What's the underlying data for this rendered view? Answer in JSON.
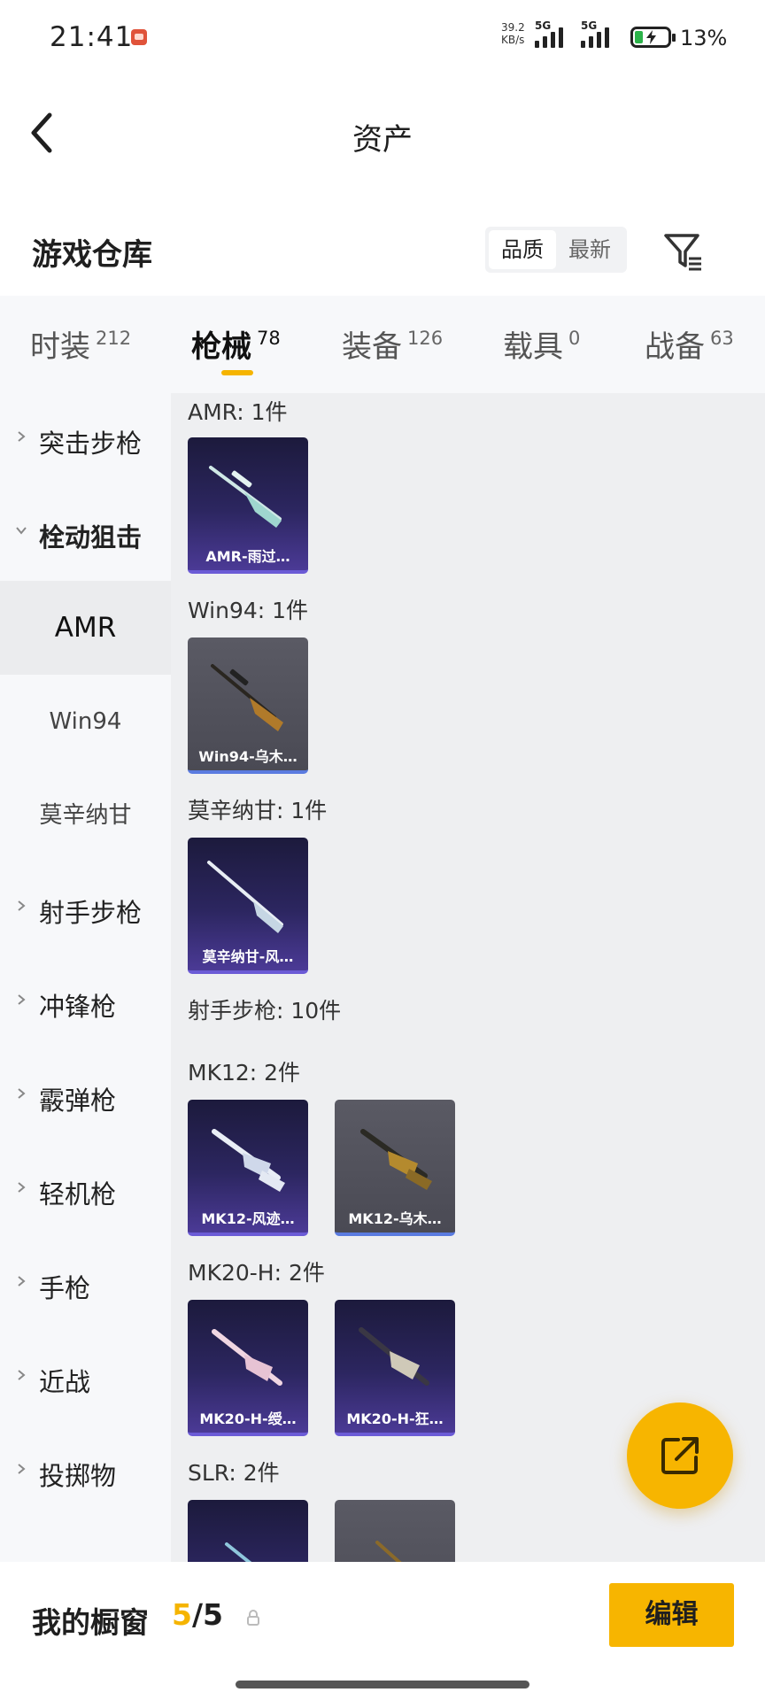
{
  "status_bar": {
    "time": "21:41",
    "net_speed_value": "39.2",
    "net_speed_unit": "KB/s",
    "signal_1": "5G",
    "signal_2": "5G",
    "battery_percent": "13%",
    "battery_level": 0.13,
    "colors": {
      "battery_fill": "#2cb34a"
    }
  },
  "header": {
    "title": "资产"
  },
  "toolbar": {
    "section_title": "游戏仓库",
    "sort_options": [
      "品质",
      "最新"
    ],
    "sort_selected": "品质"
  },
  "tabs": [
    {
      "label": "时装",
      "count": "212",
      "active": false
    },
    {
      "label": "枪械",
      "count": "78",
      "active": true
    },
    {
      "label": "装备",
      "count": "126",
      "active": false
    },
    {
      "label": "载具",
      "count": "0",
      "active": false
    },
    {
      "label": "战备",
      "count": "63",
      "active": false
    }
  ],
  "sidebar": {
    "categories": [
      {
        "label": "突击步枪",
        "expanded": false
      },
      {
        "label": "栓动狙击",
        "expanded": true
      },
      {
        "label": "射手步枪",
        "expanded": false
      },
      {
        "label": "冲锋枪",
        "expanded": false
      },
      {
        "label": "霰弹枪",
        "expanded": false
      },
      {
        "label": "轻机枪",
        "expanded": false
      },
      {
        "label": "手枪",
        "expanded": false
      },
      {
        "label": "近战",
        "expanded": false
      },
      {
        "label": "投掷物",
        "expanded": false
      }
    ],
    "subitems": [
      {
        "label": "AMR",
        "active": true
      },
      {
        "label": "Win94",
        "active": false
      },
      {
        "label": "莫辛纳甘",
        "active": false
      }
    ]
  },
  "content": {
    "groups": [
      {
        "label": "AMR: 1件",
        "items": [
          {
            "caption": "AMR-雨过…",
            "rarity": "purple"
          }
        ]
      },
      {
        "label": "Win94: 1件",
        "items": [
          {
            "caption": "Win94-乌木…",
            "rarity": "gray"
          }
        ]
      },
      {
        "label": "莫辛纳甘: 1件",
        "items": [
          {
            "caption": "莫辛纳甘-风…",
            "rarity": "purple"
          }
        ]
      },
      {
        "label": "射手步枪: 10件",
        "items": []
      },
      {
        "label": "MK12: 2件",
        "items": [
          {
            "caption": "MK12-风迹…",
            "rarity": "purple"
          },
          {
            "caption": "MK12-乌木…",
            "rarity": "gray"
          }
        ]
      },
      {
        "label": "MK20-H: 2件",
        "items": [
          {
            "caption": "MK20-H-绶…",
            "rarity": "purple"
          },
          {
            "caption": "MK20-H-狂…",
            "rarity": "purple"
          }
        ]
      },
      {
        "label": "SLR: 2件",
        "items": [
          {
            "caption": "",
            "rarity": "purple"
          },
          {
            "caption": "",
            "rarity": "gray"
          }
        ]
      }
    ]
  },
  "bottom_bar": {
    "title": "我的橱窗",
    "current": "5",
    "separator": "/",
    "total": "5",
    "edit_label": "编辑"
  },
  "colors": {
    "accent": "#f7b500",
    "rarity_purple": "#4b3a96",
    "rarity_gray": "#50505a"
  }
}
